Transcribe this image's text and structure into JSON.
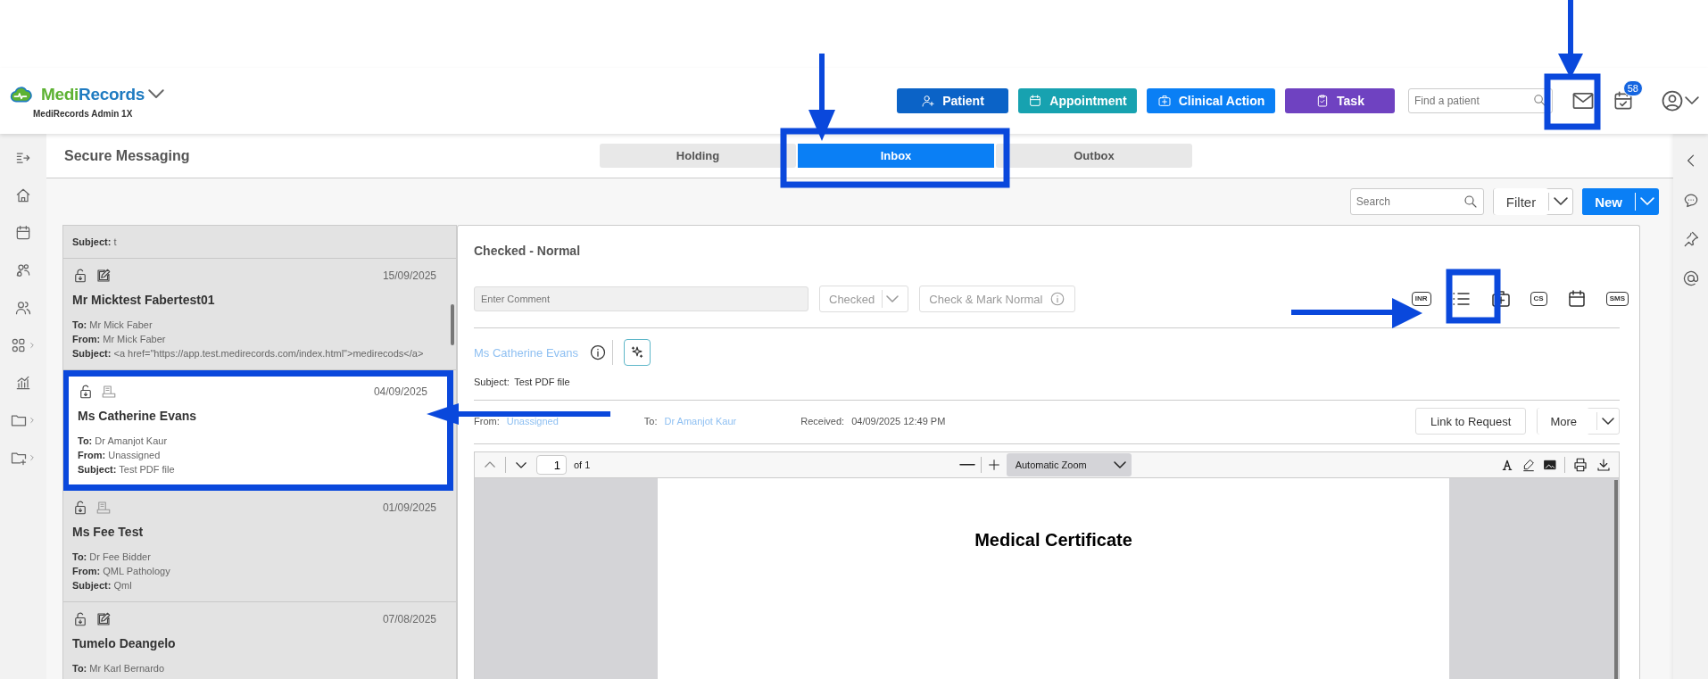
{
  "app": {
    "brand": [
      {
        "text": "Medi",
        "color": "#5db233"
      },
      {
        "text": "Records",
        "color": "#1f7bc1"
      }
    ],
    "subtitle": "MediRecords Admin 1X"
  },
  "header_buttons": [
    {
      "label": "Patient",
      "kind": "patient"
    },
    {
      "label": "Appointment",
      "kind": "appointment"
    },
    {
      "label": "Clinical Action",
      "kind": "clinical"
    },
    {
      "label": "Task",
      "kind": "task"
    }
  ],
  "patient_search": {
    "placeholder": "Find a patient"
  },
  "tasks_badge": "58",
  "page_title": "Secure Messaging",
  "tabs": [
    {
      "label": "Holding",
      "selected": false
    },
    {
      "label": "Inbox",
      "selected": true
    },
    {
      "label": "Outbox",
      "selected": false
    }
  ],
  "list_search": {
    "placeholder": "Search"
  },
  "filter_button": "Filter",
  "new_button": "New",
  "messages": [
    {
      "kind": "partial",
      "selected": false,
      "fields": [
        {
          "label": "Subject:",
          "value": "t"
        }
      ]
    },
    {
      "kind": "note",
      "selected": false,
      "date": "15/09/2025",
      "name": "Mr Micktest Fabertest01",
      "fields": [
        {
          "label": "To:",
          "value": "Mr Mick Faber"
        },
        {
          "label": "From:",
          "value": "Mr Mick Faber"
        },
        {
          "label": "Subject:",
          "value": "<a href=\"https://app.test.medirecords.com/index.html\">medirecods</a>"
        }
      ]
    },
    {
      "kind": "scan",
      "selected": true,
      "date": "04/09/2025",
      "name": "Ms Catherine Evans",
      "fields": [
        {
          "label": "To:",
          "value": "Dr Amanjot Kaur"
        },
        {
          "label": "From:",
          "value": "Unassigned"
        },
        {
          "label": "Subject:",
          "value": "Test PDF file"
        }
      ]
    },
    {
      "kind": "scan",
      "selected": false,
      "date": "01/09/2025",
      "name": "Ms Fee Test",
      "fields": [
        {
          "label": "To:",
          "value": "Dr Fee Bidder"
        },
        {
          "label": "From:",
          "value": "QML Pathology"
        },
        {
          "label": "Subject:",
          "value": "Qml"
        }
      ]
    },
    {
      "kind": "note",
      "selected": false,
      "date": "07/08/2025",
      "name": "Tumelo Deangelo",
      "fields": [
        {
          "label": "To:",
          "value": "Mr Karl Bernardo"
        }
      ]
    }
  ],
  "detail": {
    "status_title": "Checked - Normal",
    "comment": {
      "placeholder": "Enter Comment"
    },
    "checked_dropdown": {
      "label": "Checked",
      "disabled": true
    },
    "check_mark_button": {
      "label": "Check & Mark Normal",
      "disabled": true
    },
    "tool_icons": [
      {
        "kind": "inr",
        "label": "INR"
      },
      {
        "kind": "list"
      },
      {
        "kind": "medkit"
      },
      {
        "kind": "cs",
        "label": "CS"
      },
      {
        "kind": "calendar"
      },
      {
        "kind": "sms",
        "label": "SMS"
      }
    ],
    "patient_name": "Ms Catherine Evans",
    "subject": {
      "label": "Subject:",
      "value": "Test PDF file"
    },
    "meta": [
      {
        "label": "From:",
        "value": "Unassigned",
        "kind": "link"
      },
      {
        "label": "To:",
        "value": "Dr Amanjot Kaur",
        "kind": "link"
      },
      {
        "label": "Received:",
        "value": "04/09/2025 12:49 PM",
        "kind": "text"
      }
    ],
    "link_button": "Link to Request",
    "more_button": "More"
  },
  "pdf": {
    "page": "1",
    "page_count": "of 1",
    "zoom": "Automatic Zoom",
    "document_title": "Medical Certificate"
  }
}
